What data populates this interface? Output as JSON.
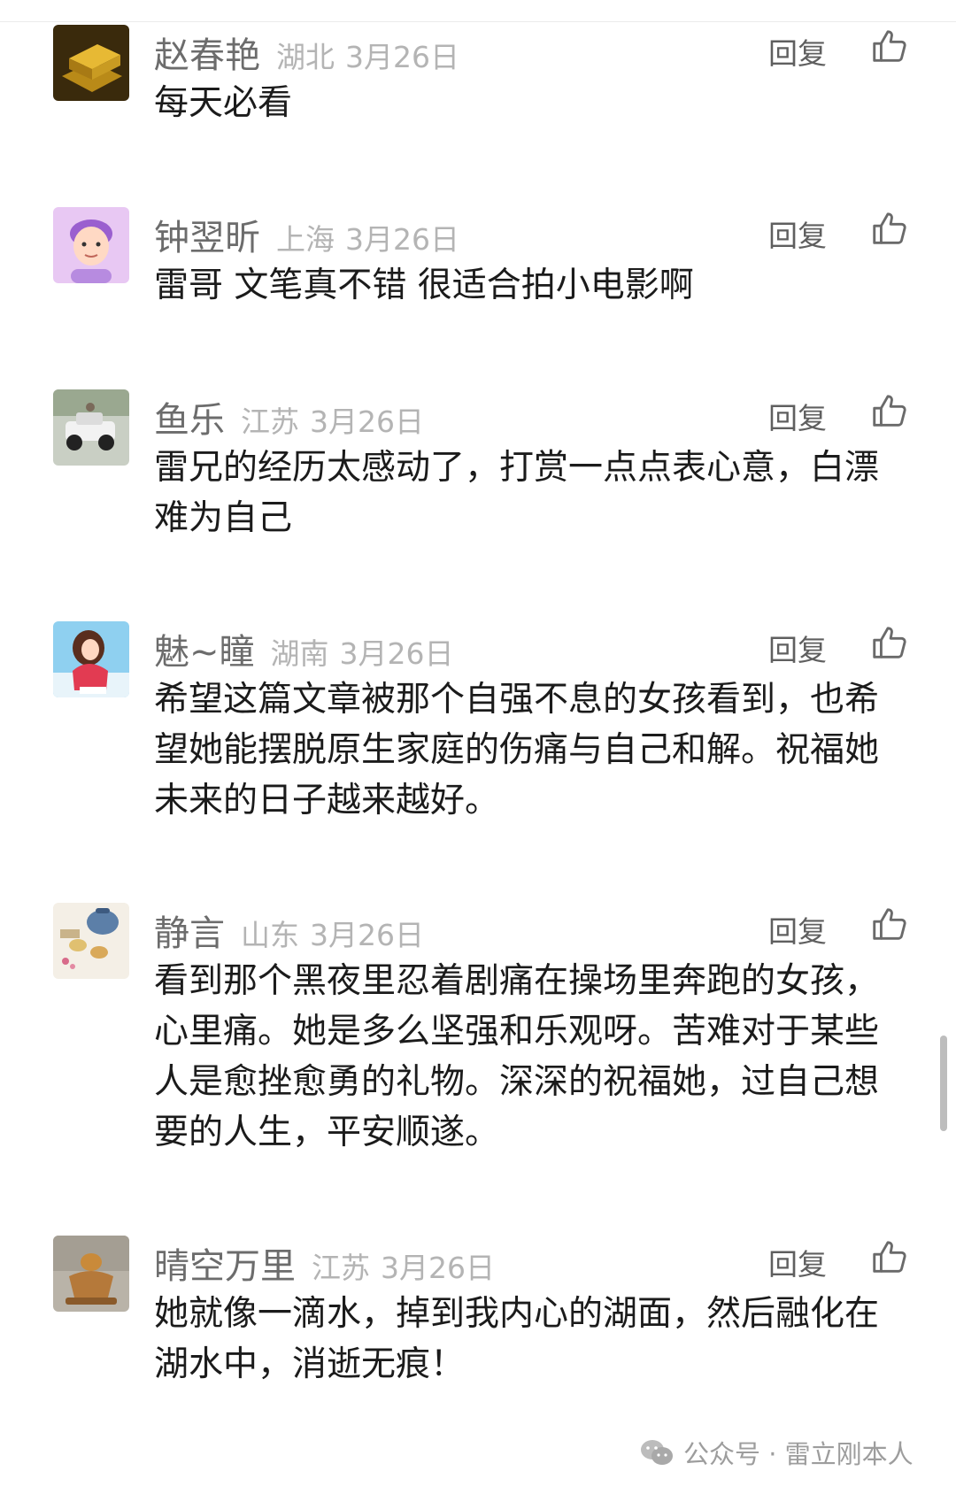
{
  "comments": [
    {
      "name": "赵春艳",
      "location": "湖北",
      "date": "3月26日",
      "reply": "回复",
      "text": "每天必看",
      "avatar": "gold-bars-avatar-icon"
    },
    {
      "name": "钟翌昕",
      "location": "上海",
      "date": "3月26日",
      "reply": "回复",
      "text": "雷哥 文笔真不错 很适合拍小电影啊",
      "avatar": "cartoon-person-avatar-icon"
    },
    {
      "name": "鱼乐",
      "location": "江苏",
      "date": "3月26日",
      "reply": "回复",
      "text": "雷兄的经历太感动了，打赏一点点表心意，白漂难为自己",
      "avatar": "toy-car-avatar-icon"
    },
    {
      "name": "魅~瞳",
      "location": "湖南",
      "date": "3月26日",
      "reply": "回复",
      "text": "希望这篇文章被那个自强不息的女孩看到，也希望她能摆脱原生家庭的伤痛与自己和解。祝福她未来的日子越来越好。",
      "avatar": "girl-avatar-icon"
    },
    {
      "name": "静言",
      "location": "山东",
      "date": "3月26日",
      "reply": "回复",
      "text": "看到那个黑夜里忍着剧痛在操场里奔跑的女孩，心里痛。她是多么坚强和乐观呀。苦难对于某些人是愈挫愈勇的礼物。深深的祝福她，过自己想要的人生，平安顺遂。",
      "avatar": "tea-set-avatar-icon"
    },
    {
      "name": "晴空万里",
      "location": "江苏",
      "date": "3月26日",
      "reply": "回复",
      "text": "她就像一滴水，掉到我内心的湖面，然后融化在湖水中，消逝无痕！",
      "avatar": "incense-burner-avatar-icon"
    }
  ],
  "watermark": "公众号 · 雷立刚本人",
  "colors": {
    "name": "#6c6c6c",
    "meta": "#b4b4b4",
    "text": "#1b1b1b",
    "reply": "#5f5f5f"
  }
}
